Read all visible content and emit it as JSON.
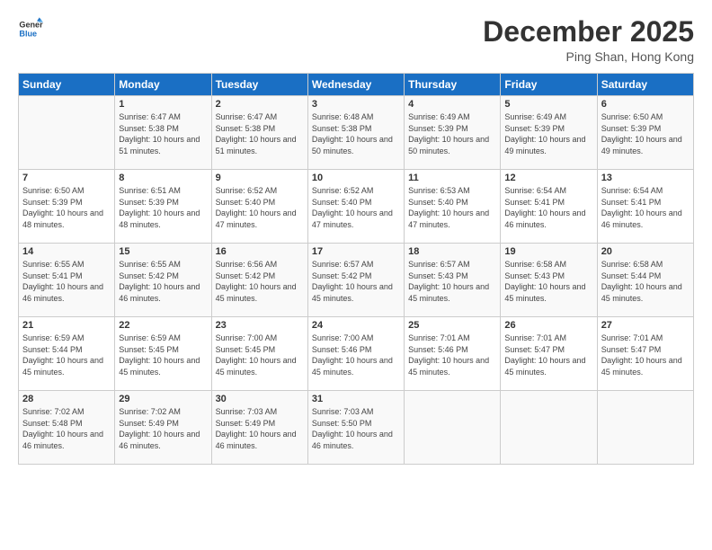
{
  "header": {
    "logo_line1": "General",
    "logo_line2": "Blue",
    "month": "December 2025",
    "location": "Ping Shan, Hong Kong"
  },
  "days_of_week": [
    "Sunday",
    "Monday",
    "Tuesday",
    "Wednesday",
    "Thursday",
    "Friday",
    "Saturday"
  ],
  "weeks": [
    [
      {
        "day": "",
        "sunrise": "",
        "sunset": "",
        "daylight": ""
      },
      {
        "day": "1",
        "sunrise": "Sunrise: 6:47 AM",
        "sunset": "Sunset: 5:38 PM",
        "daylight": "Daylight: 10 hours and 51 minutes."
      },
      {
        "day": "2",
        "sunrise": "Sunrise: 6:47 AM",
        "sunset": "Sunset: 5:38 PM",
        "daylight": "Daylight: 10 hours and 51 minutes."
      },
      {
        "day": "3",
        "sunrise": "Sunrise: 6:48 AM",
        "sunset": "Sunset: 5:38 PM",
        "daylight": "Daylight: 10 hours and 50 minutes."
      },
      {
        "day": "4",
        "sunrise": "Sunrise: 6:49 AM",
        "sunset": "Sunset: 5:39 PM",
        "daylight": "Daylight: 10 hours and 50 minutes."
      },
      {
        "day": "5",
        "sunrise": "Sunrise: 6:49 AM",
        "sunset": "Sunset: 5:39 PM",
        "daylight": "Daylight: 10 hours and 49 minutes."
      },
      {
        "day": "6",
        "sunrise": "Sunrise: 6:50 AM",
        "sunset": "Sunset: 5:39 PM",
        "daylight": "Daylight: 10 hours and 49 minutes."
      }
    ],
    [
      {
        "day": "7",
        "sunrise": "Sunrise: 6:50 AM",
        "sunset": "Sunset: 5:39 PM",
        "daylight": "Daylight: 10 hours and 48 minutes."
      },
      {
        "day": "8",
        "sunrise": "Sunrise: 6:51 AM",
        "sunset": "Sunset: 5:39 PM",
        "daylight": "Daylight: 10 hours and 48 minutes."
      },
      {
        "day": "9",
        "sunrise": "Sunrise: 6:52 AM",
        "sunset": "Sunset: 5:40 PM",
        "daylight": "Daylight: 10 hours and 47 minutes."
      },
      {
        "day": "10",
        "sunrise": "Sunrise: 6:52 AM",
        "sunset": "Sunset: 5:40 PM",
        "daylight": "Daylight: 10 hours and 47 minutes."
      },
      {
        "day": "11",
        "sunrise": "Sunrise: 6:53 AM",
        "sunset": "Sunset: 5:40 PM",
        "daylight": "Daylight: 10 hours and 47 minutes."
      },
      {
        "day": "12",
        "sunrise": "Sunrise: 6:54 AM",
        "sunset": "Sunset: 5:41 PM",
        "daylight": "Daylight: 10 hours and 46 minutes."
      },
      {
        "day": "13",
        "sunrise": "Sunrise: 6:54 AM",
        "sunset": "Sunset: 5:41 PM",
        "daylight": "Daylight: 10 hours and 46 minutes."
      }
    ],
    [
      {
        "day": "14",
        "sunrise": "Sunrise: 6:55 AM",
        "sunset": "Sunset: 5:41 PM",
        "daylight": "Daylight: 10 hours and 46 minutes."
      },
      {
        "day": "15",
        "sunrise": "Sunrise: 6:55 AM",
        "sunset": "Sunset: 5:42 PM",
        "daylight": "Daylight: 10 hours and 46 minutes."
      },
      {
        "day": "16",
        "sunrise": "Sunrise: 6:56 AM",
        "sunset": "Sunset: 5:42 PM",
        "daylight": "Daylight: 10 hours and 45 minutes."
      },
      {
        "day": "17",
        "sunrise": "Sunrise: 6:57 AM",
        "sunset": "Sunset: 5:42 PM",
        "daylight": "Daylight: 10 hours and 45 minutes."
      },
      {
        "day": "18",
        "sunrise": "Sunrise: 6:57 AM",
        "sunset": "Sunset: 5:43 PM",
        "daylight": "Daylight: 10 hours and 45 minutes."
      },
      {
        "day": "19",
        "sunrise": "Sunrise: 6:58 AM",
        "sunset": "Sunset: 5:43 PM",
        "daylight": "Daylight: 10 hours and 45 minutes."
      },
      {
        "day": "20",
        "sunrise": "Sunrise: 6:58 AM",
        "sunset": "Sunset: 5:44 PM",
        "daylight": "Daylight: 10 hours and 45 minutes."
      }
    ],
    [
      {
        "day": "21",
        "sunrise": "Sunrise: 6:59 AM",
        "sunset": "Sunset: 5:44 PM",
        "daylight": "Daylight: 10 hours and 45 minutes."
      },
      {
        "day": "22",
        "sunrise": "Sunrise: 6:59 AM",
        "sunset": "Sunset: 5:45 PM",
        "daylight": "Daylight: 10 hours and 45 minutes."
      },
      {
        "day": "23",
        "sunrise": "Sunrise: 7:00 AM",
        "sunset": "Sunset: 5:45 PM",
        "daylight": "Daylight: 10 hours and 45 minutes."
      },
      {
        "day": "24",
        "sunrise": "Sunrise: 7:00 AM",
        "sunset": "Sunset: 5:46 PM",
        "daylight": "Daylight: 10 hours and 45 minutes."
      },
      {
        "day": "25",
        "sunrise": "Sunrise: 7:01 AM",
        "sunset": "Sunset: 5:46 PM",
        "daylight": "Daylight: 10 hours and 45 minutes."
      },
      {
        "day": "26",
        "sunrise": "Sunrise: 7:01 AM",
        "sunset": "Sunset: 5:47 PM",
        "daylight": "Daylight: 10 hours and 45 minutes."
      },
      {
        "day": "27",
        "sunrise": "Sunrise: 7:01 AM",
        "sunset": "Sunset: 5:47 PM",
        "daylight": "Daylight: 10 hours and 45 minutes."
      }
    ],
    [
      {
        "day": "28",
        "sunrise": "Sunrise: 7:02 AM",
        "sunset": "Sunset: 5:48 PM",
        "daylight": "Daylight: 10 hours and 46 minutes."
      },
      {
        "day": "29",
        "sunrise": "Sunrise: 7:02 AM",
        "sunset": "Sunset: 5:49 PM",
        "daylight": "Daylight: 10 hours and 46 minutes."
      },
      {
        "day": "30",
        "sunrise": "Sunrise: 7:03 AM",
        "sunset": "Sunset: 5:49 PM",
        "daylight": "Daylight: 10 hours and 46 minutes."
      },
      {
        "day": "31",
        "sunrise": "Sunrise: 7:03 AM",
        "sunset": "Sunset: 5:50 PM",
        "daylight": "Daylight: 10 hours and 46 minutes."
      },
      {
        "day": "",
        "sunrise": "",
        "sunset": "",
        "daylight": ""
      },
      {
        "day": "",
        "sunrise": "",
        "sunset": "",
        "daylight": ""
      },
      {
        "day": "",
        "sunrise": "",
        "sunset": "",
        "daylight": ""
      }
    ]
  ]
}
